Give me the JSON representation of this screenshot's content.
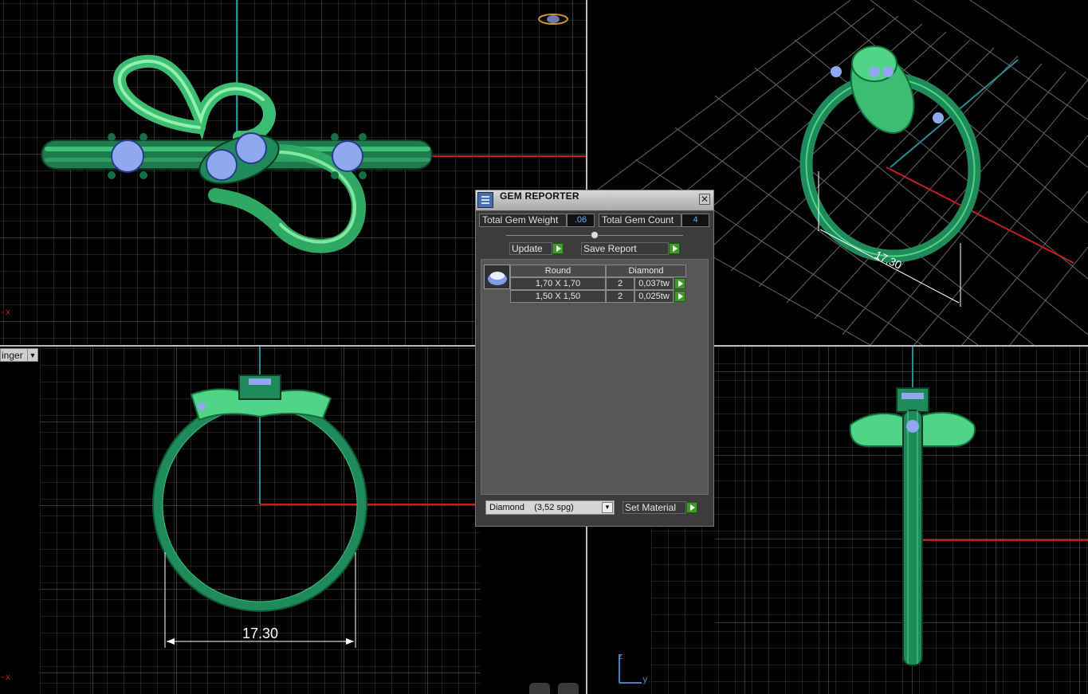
{
  "window_title": "GEM REPORTER",
  "viewports": {
    "front_view": {
      "axis_label": "-x",
      "dimension": ""
    },
    "perspective_view": {
      "dimension": "17,30"
    },
    "side_view": {
      "view_selector": "inger",
      "axis_label": "-x",
      "dimension": "17.30"
    },
    "right_view": {
      "axis_labels": {
        "vertical": "z",
        "horizontal": "y"
      }
    }
  },
  "gem_reporter": {
    "title": "GEM REPORTER",
    "close_label": "✕",
    "total_gem_weight_label": "Total Gem Weight",
    "total_gem_weight_value": ".06",
    "total_gem_count_label": "Total Gem Count",
    "total_gem_count_value": "4",
    "update_label": "Update",
    "save_report_label": "Save Report",
    "table": {
      "headers": [
        "Round",
        "Diamond"
      ],
      "rows": [
        {
          "size": "1,70 X 1,70",
          "count": "2",
          "weight": "0,037tw"
        },
        {
          "size": "1,50 X 1,50",
          "count": "2",
          "weight": "0,025tw"
        }
      ]
    },
    "material_value": "Diamond    (3,52 spg)",
    "set_material_label": "Set Material"
  },
  "colors": {
    "metal": "#1f8a5a",
    "metal_highlight": "#5fd98a",
    "gem": "#8fa8f0",
    "grid": "#3a3a3a",
    "axis_x": "#c02020",
    "axis_y": "#2a8a95",
    "value_text": "#5ea4ff"
  },
  "icons": [
    "gem-round-icon",
    "play-icon",
    "close-icon",
    "dropdown-arrow-icon",
    "slider-knob-icon"
  ]
}
